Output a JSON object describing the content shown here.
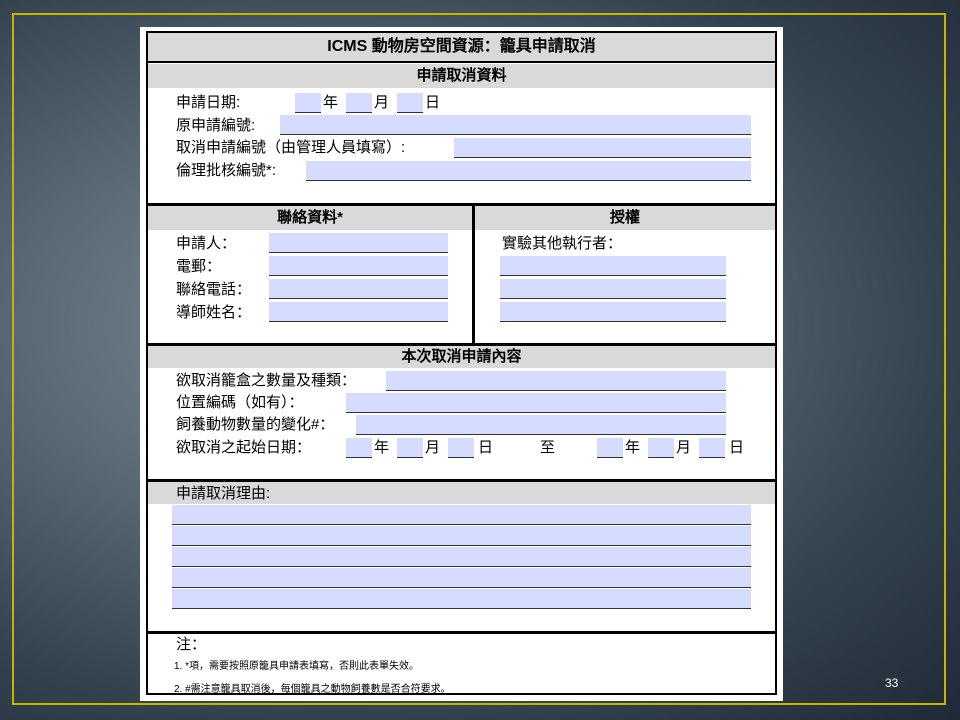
{
  "form": {
    "title": "ICMS 動物房空間資源：籠具申請取消",
    "section1": {
      "header": "申請取消資料",
      "apply_date_label": "申請日期:",
      "year": "年",
      "month": "月",
      "day": "日",
      "original_no_label": "原申請編號:",
      "cancel_no_label": "取消申請編號（由管理人員填寫）:",
      "ethics_no_label": "倫理批核編號*:"
    },
    "contact": {
      "header": "聯絡資料*",
      "applicant_label": "申請人：",
      "email_label": "電郵：",
      "phone_label": "聯絡電話：",
      "supervisor_label": "導師姓名："
    },
    "auth": {
      "header": "授權",
      "other_executor_label": "實驗其他執行者："
    },
    "content": {
      "header": "本次取消申請內容",
      "cage_count_label": "欲取消籠盒之數量及種類：",
      "location_label": "位置編碼（如有）：",
      "animal_change_label": "飼養動物數量的變化#：",
      "date_range_label": "欲取消之起始日期：",
      "year": "年",
      "month": "月",
      "day": "日",
      "to": "至"
    },
    "reason": {
      "label": "申請取消理由:"
    },
    "notes": {
      "header": "注：",
      "note1": "1. *項，需要按照原籠具申請表填寫，否則此表單失效。",
      "note2": "2. #需注意籠具取消後，每個籠具之動物飼養數是否合符要求。"
    }
  },
  "slide": {
    "page_number": "33"
  }
}
